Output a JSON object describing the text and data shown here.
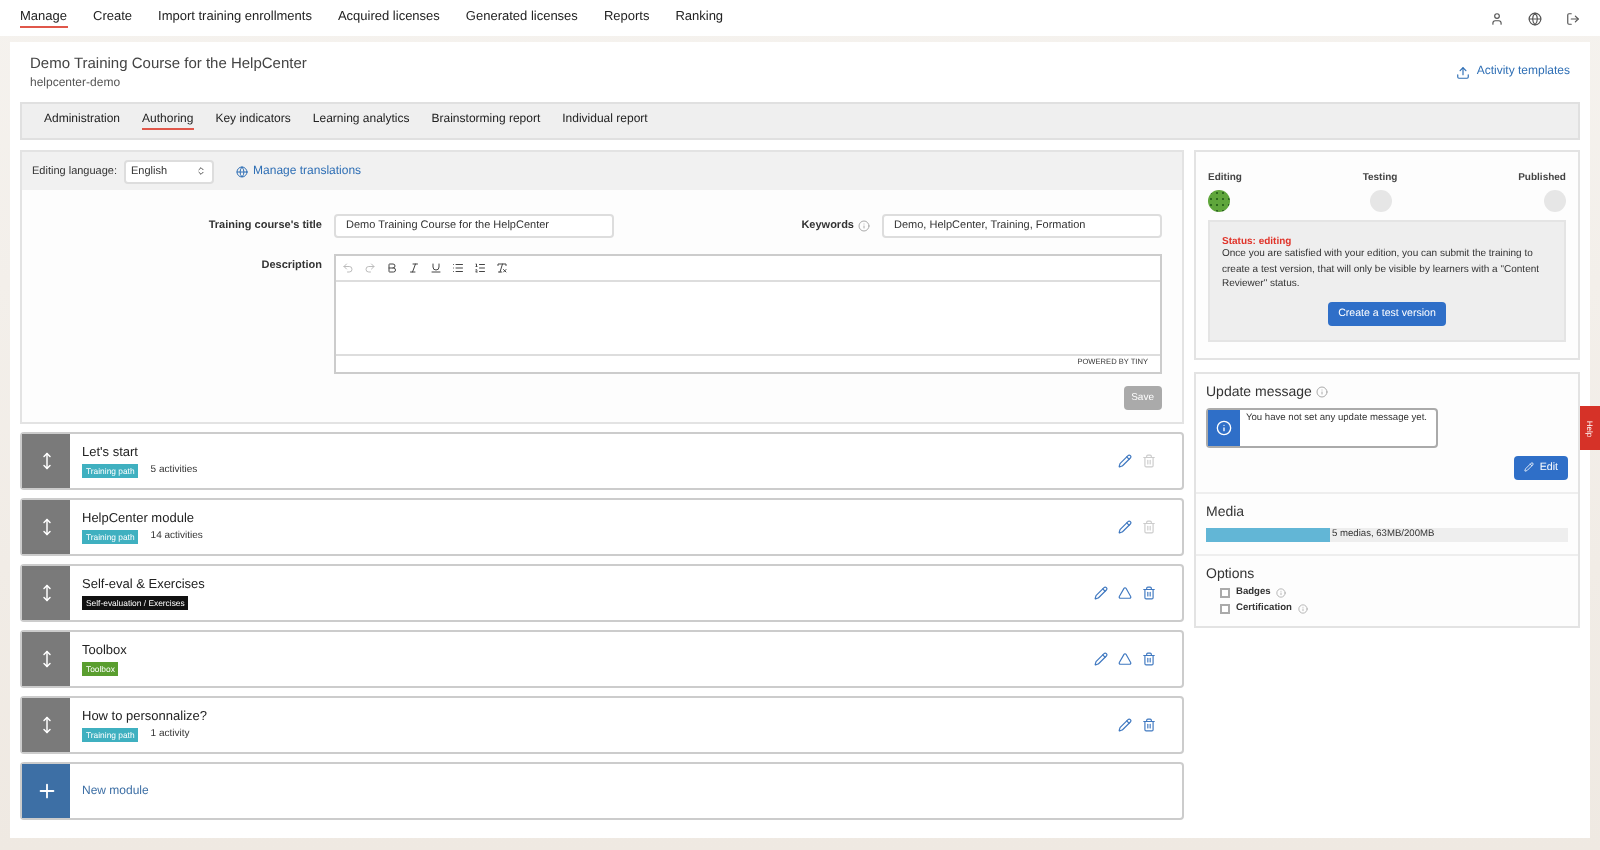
{
  "top_nav": [
    {
      "label": "Manage",
      "selected": true
    },
    {
      "label": "Create",
      "selected": false
    },
    {
      "label": "Import training enrollments",
      "selected": false
    },
    {
      "label": "Acquired licenses",
      "selected": false
    },
    {
      "label": "Generated licenses",
      "selected": false
    },
    {
      "label": "Reports",
      "selected": false
    },
    {
      "label": "Ranking",
      "selected": false
    }
  ],
  "course": {
    "title": "Demo Training Course for the HelpCenter",
    "subtitle": "helpcenter-demo",
    "templates_link": "Activity templates"
  },
  "tabs": [
    {
      "label": "Administration",
      "selected": false
    },
    {
      "label": "Authoring",
      "selected": true
    },
    {
      "label": "Key indicators",
      "selected": false
    },
    {
      "label": "Learning analytics",
      "selected": false
    },
    {
      "label": "Brainstorming report",
      "selected": false
    },
    {
      "label": "Individual report",
      "selected": false
    }
  ],
  "editing_language": {
    "label": "Editing language:",
    "value": "English",
    "manage_link": "Manage translations"
  },
  "form": {
    "title_label": "Training course's title",
    "title_value": "Demo Training Course for the HelpCenter",
    "keywords_label": "Keywords",
    "keywords_value": "Demo, HelpCenter, Training, Formation",
    "description_label": "Description",
    "editor_footer": "POWERED BY TINY",
    "save_button": "Save"
  },
  "modules": [
    {
      "title": "Let's start",
      "tag": "Training path",
      "color": "#3fb0c0",
      "count": "5 activities",
      "shareable": false,
      "delete_disabled": true
    },
    {
      "title": "HelpCenter module",
      "tag": "Training path",
      "color": "#3fb0c0",
      "count": "14 activities",
      "shareable": false,
      "delete_disabled": true
    },
    {
      "title": "Self-eval & Exercises",
      "tag": "Self-evaluation / Exercises",
      "color": "#111111",
      "shareable": true,
      "delete_disabled": false
    },
    {
      "title": "Toolbox",
      "tag": "Toolbox",
      "color": "#5a9e2f",
      "shareable": true,
      "delete_disabled": false
    },
    {
      "title": "How to personnalize?",
      "tag": "Training path",
      "color": "#3fb0c0",
      "count": "1 activity",
      "shareable": false,
      "delete_disabled": false
    }
  ],
  "new_module": "New module",
  "status": {
    "steps": [
      {
        "label": "Editing",
        "selected": true
      },
      {
        "label": "Testing",
        "selected": false
      },
      {
        "label": "Published",
        "selected": false
      }
    ],
    "status_label": "Status: editing",
    "message": "Once you are satisfied with your edition, you can submit the training to create a test version, that will only be visible by learners with a \"Content Reviewer\" status.",
    "button": "Create a test version"
  },
  "update_message": {
    "heading": "Update message",
    "notice": "You have not set any update message yet.",
    "edit_button": "Edit"
  },
  "media": {
    "heading": "Media",
    "level": 0.34,
    "reading": "5 medias, 63MB/200MB"
  },
  "options": {
    "heading": "Options",
    "items": [
      {
        "label": "Badges",
        "checked": false
      },
      {
        "label": "Certification",
        "checked": false
      }
    ]
  },
  "help_tab": "Help"
}
